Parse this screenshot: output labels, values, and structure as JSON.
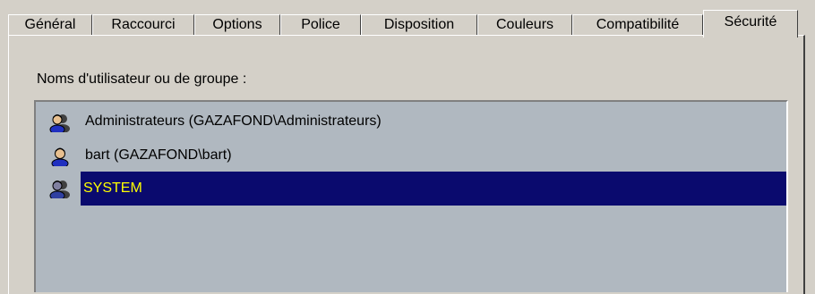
{
  "tabs": [
    {
      "label": "Général"
    },
    {
      "label": "Raccourci"
    },
    {
      "label": "Options"
    },
    {
      "label": "Police"
    },
    {
      "label": "Disposition"
    },
    {
      "label": "Couleurs"
    },
    {
      "label": "Compatibilité"
    },
    {
      "label": "Sécurité",
      "active": true
    }
  ],
  "security": {
    "names_label": "Noms d'utilisateur ou de groupe :",
    "users": [
      {
        "label": "Administrateurs (GAZAFOND\\Administrateurs)",
        "icon": "user-group-icon"
      },
      {
        "label": "bart (GAZAFOND\\bart)",
        "icon": "user-icon"
      },
      {
        "label": "SYSTEM",
        "icon": "user-group-icon",
        "selected": true
      }
    ]
  },
  "colors": {
    "selection_bg": "#0a0a6e",
    "selection_text": "#ffff00",
    "list_bg": "#b0b8c0",
    "dialog_bg": "#d4d0c8"
  }
}
